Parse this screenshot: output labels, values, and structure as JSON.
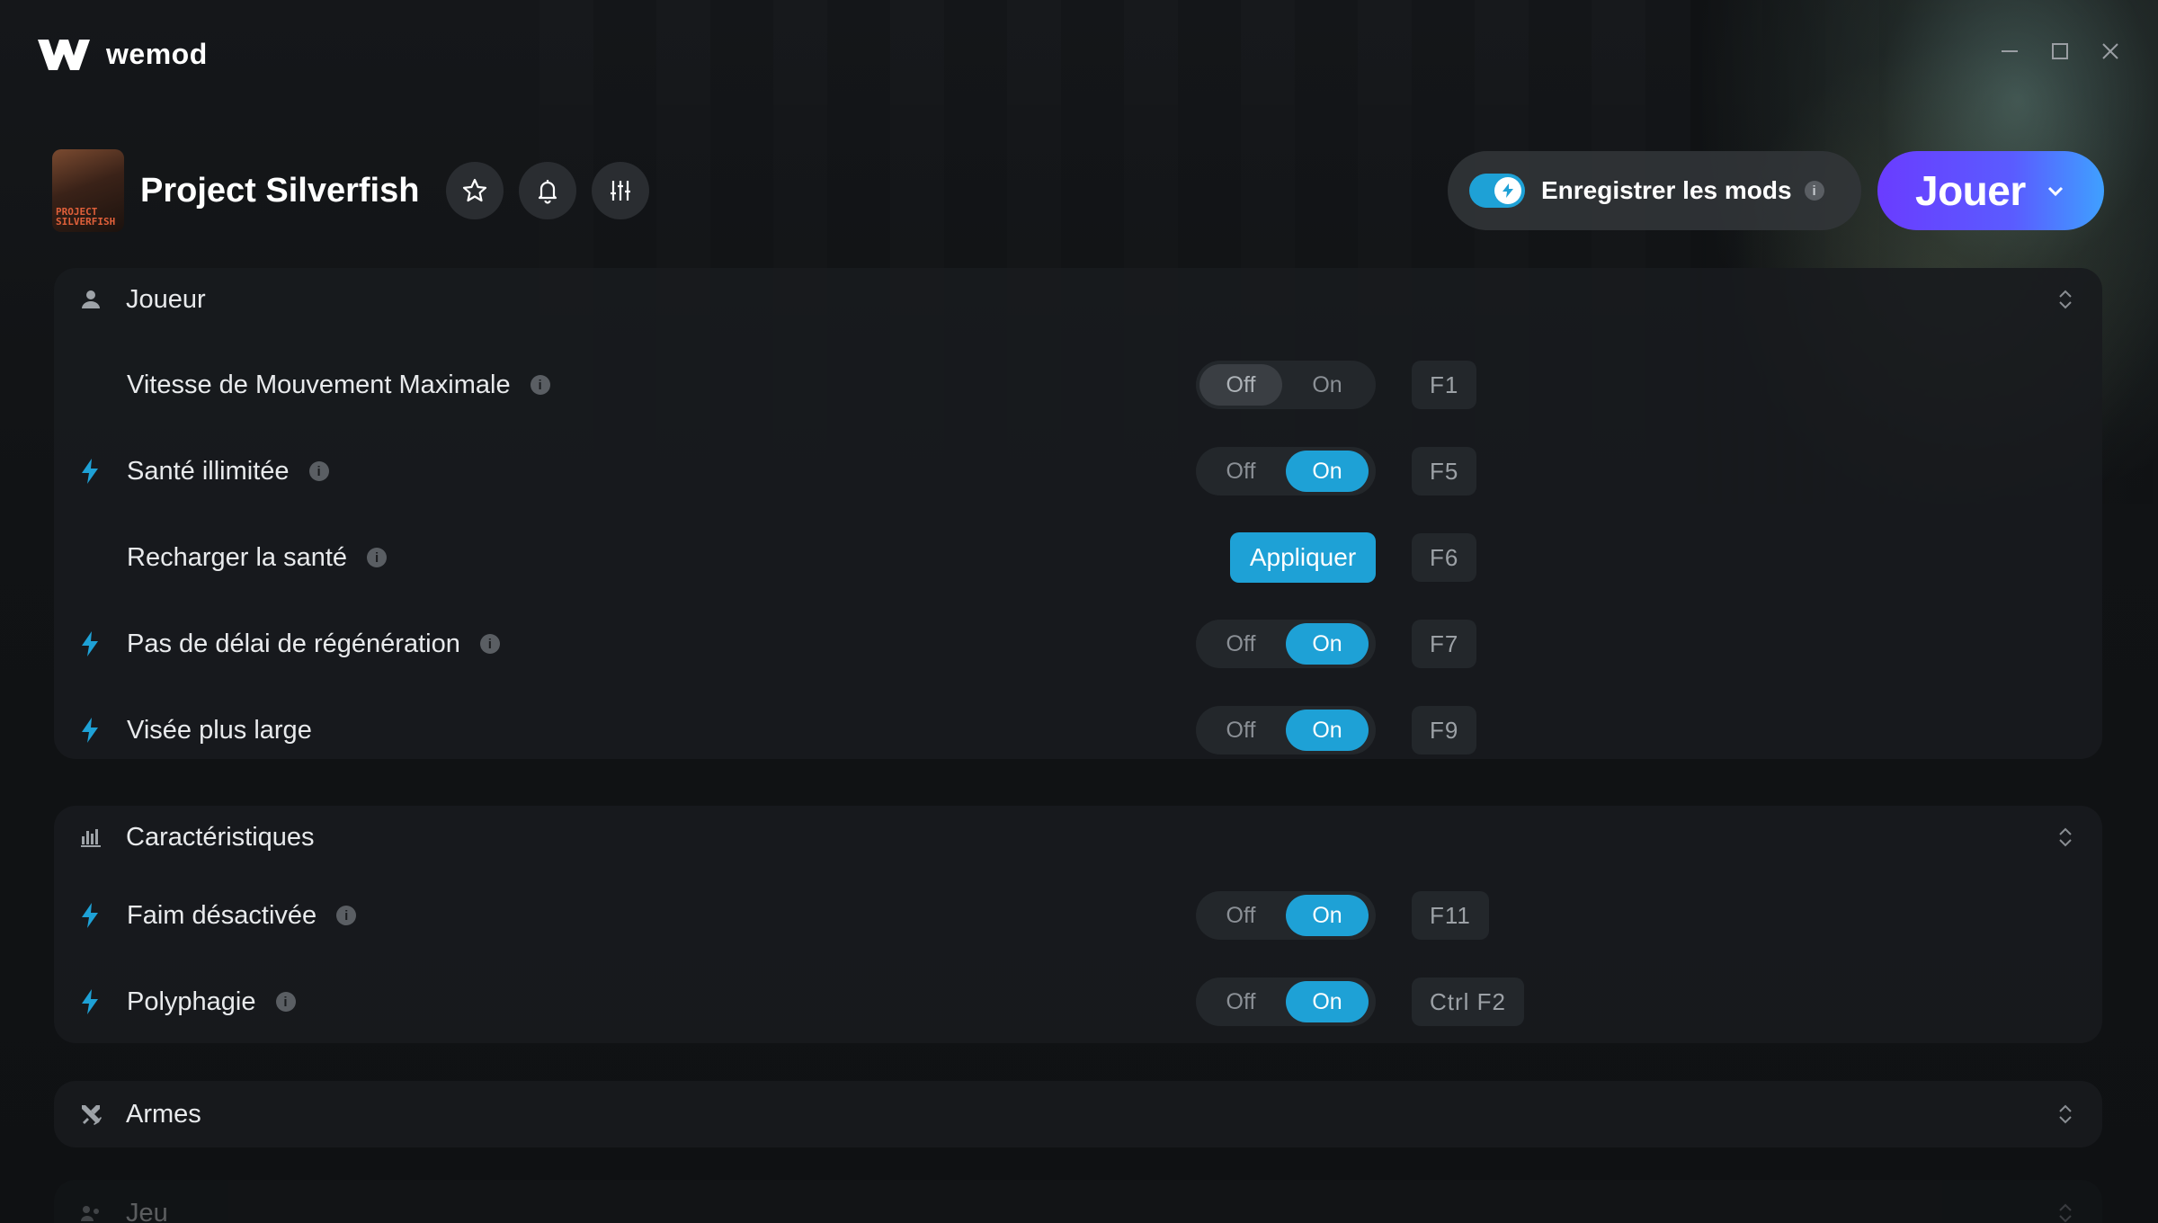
{
  "app": {
    "name": "wemod"
  },
  "game": {
    "title": "Project Silverfish",
    "thumb_text": "PROJECT SILVERFISH"
  },
  "header_icons": [
    "star-icon",
    "bell-icon",
    "sliders-icon"
  ],
  "save_mods": {
    "label": "Enregistrer les mods",
    "info": "i",
    "enabled": true
  },
  "play": {
    "label": "Jouer"
  },
  "colors": {
    "accent": "#1ea1d6",
    "play_gradient_start": "#6a3cff",
    "play_gradient_end": "#3fa0ff",
    "background": "#101214"
  },
  "sections": [
    {
      "title": "Joueur",
      "icon": "person-icon",
      "rows": [
        {
          "label": "Vitesse de Mouvement Maximale",
          "control": "toggle",
          "state": "Off",
          "off": "Off",
          "on": "On",
          "hotkey": "F1",
          "bolt": false
        },
        {
          "label": "Santé illimitée",
          "control": "toggle",
          "state": "On",
          "off": "Off",
          "on": "On",
          "hotkey": "F5",
          "bolt": true
        },
        {
          "label": "Recharger la santé",
          "control": "button",
          "button": "Appliquer",
          "hotkey": "F6",
          "bolt": false
        },
        {
          "label": "Pas de délai de régénération",
          "control": "toggle",
          "state": "On",
          "off": "Off",
          "on": "On",
          "hotkey": "F7",
          "bolt": true
        },
        {
          "label": "Visée plus large",
          "control": "toggle",
          "state": "On",
          "off": "Off",
          "on": "On",
          "hotkey": "F9",
          "bolt": true
        }
      ]
    },
    {
      "title": "Caractéristiques",
      "icon": "bar-chart-icon",
      "rows": [
        {
          "label": "Faim désactivée",
          "control": "toggle",
          "state": "On",
          "off": "Off",
          "on": "On",
          "hotkey": "F11",
          "bolt": true
        },
        {
          "label": "Polyphagie",
          "control": "toggle",
          "state": "On",
          "off": "Off",
          "on": "On",
          "hotkey": "Ctrl F2",
          "bolt": true
        }
      ]
    },
    {
      "title": "Armes",
      "icon": "crossed-swords-icon",
      "rows": []
    },
    {
      "title": "Jeu",
      "icon": "gamepad-icon",
      "rows": []
    }
  ]
}
